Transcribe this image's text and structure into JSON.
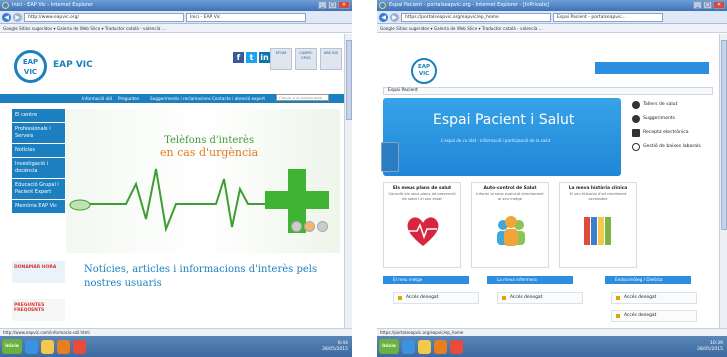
{
  "left": {
    "window_title": "Inici - EAP Vic - Internet Explorer",
    "address": "http://www.eapvic.org/",
    "tab_title": "Inici - EAP Vic",
    "favorites": "Google  Sitios sugeridos ▾  Galería de Web Slice ▾  Traductor català - valencià ...",
    "logo": "EAP VIC",
    "site_name": "EAP VIC",
    "badges": [
      "EFQM",
      "CAMFiC EPUS",
      "ABS IDS"
    ],
    "menu": [
      "Informació útil",
      "Preguntes",
      "Suggeriments i reclamacions",
      "Contacte i atenció expert"
    ],
    "search_placeholder": "Cercar a la nostra web",
    "sidenav": [
      "El centre",
      "Professionals i Serveis",
      "Notícies",
      "Investigació i docència",
      "Educació Grupal i Pacient Expert",
      "Memòria EAP Vic"
    ],
    "hero_line1": "Telèfons d'interès",
    "hero_line2": "en cas d'urgència",
    "promo1": "DONAMAR HORA",
    "promo2": "PREGUNTES FREQÜENTS",
    "news_title": "Notícies, articles i informacions d'interès pels nostres usuaris",
    "status_url": "http://www.eapvic.com/informacio-util.html",
    "clock_time": "8:44",
    "clock_date": "28/05/2015"
  },
  "right": {
    "window_title": "Espai Pacient - portalseapvic.org - Internet Explorer - [InPrivate]",
    "address": "https://portalseapvic.org/eapvic/ep_home",
    "tab_title": "Espai Pacient - portalseapvic...",
    "favorites": "Google  Sitios sugeridos ▾  Galería de Web Slice ▾  Traductor català - valencià ...",
    "logo": "EAP VIC",
    "breadcrumb": "Espai Pacient",
    "banner_title": "Espai Pacient i Salut",
    "banner_sub": "L'espai de cu  idat · informació i participació de la salut",
    "side_links": [
      "Tallers de salut",
      "Suggeriments",
      "Recepta electrònica",
      "Gestió de baixes laborals"
    ],
    "cards": [
      {
        "title": "Els meus plans de salut",
        "desc": "Consulti els seus plans de prevenció de salut i el seu estat"
      },
      {
        "title": "Auto-control de Salut",
        "desc": "Informi la seva evolució directament al seu metge"
      },
      {
        "title": "La meva història clínica",
        "desc": "El seu historial d'alt rendiment accessible"
      }
    ],
    "bars": [
      "El meu metge",
      "La meva infermera",
      "Endocrinòleg / Dietista"
    ],
    "item_text": "Accés denegat",
    "status_url": "https://portalseapvic.org/eapvic/ep_home",
    "clock_time": "10:39",
    "clock_date": "28/05/2015"
  },
  "colors": {
    "brand_blue": "#1c7fbf",
    "portal_blue": "#2d8ee0",
    "green": "#3e9e33",
    "orange": "#e27a1f"
  }
}
